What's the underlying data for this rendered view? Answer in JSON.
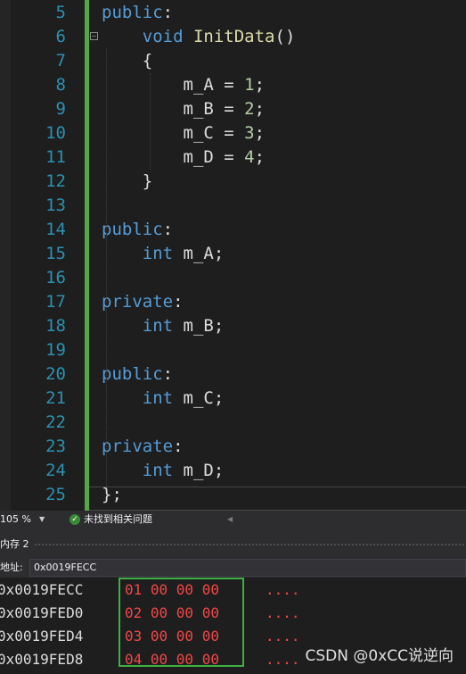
{
  "editor": {
    "lines": [
      {
        "n": "5",
        "tokens": [
          {
            "t": "public",
            "c": "kw"
          },
          {
            "t": ":",
            "c": ""
          }
        ]
      },
      {
        "n": "6",
        "tokens": [
          {
            "t": "    ",
            "c": ""
          },
          {
            "t": "void",
            "c": "kw"
          },
          {
            "t": " ",
            "c": ""
          },
          {
            "t": "InitData",
            "c": "fn"
          },
          {
            "t": "()",
            "c": ""
          }
        ]
      },
      {
        "n": "7",
        "tokens": [
          {
            "t": "    {",
            "c": ""
          }
        ]
      },
      {
        "n": "8",
        "tokens": [
          {
            "t": "        m_A = ",
            "c": ""
          },
          {
            "t": "1",
            "c": "num"
          },
          {
            "t": ";",
            "c": ""
          }
        ]
      },
      {
        "n": "9",
        "tokens": [
          {
            "t": "        m_B = ",
            "c": ""
          },
          {
            "t": "2",
            "c": "num"
          },
          {
            "t": ";",
            "c": ""
          }
        ]
      },
      {
        "n": "10",
        "tokens": [
          {
            "t": "        m_C = ",
            "c": ""
          },
          {
            "t": "3",
            "c": "num"
          },
          {
            "t": ";",
            "c": ""
          }
        ]
      },
      {
        "n": "11",
        "tokens": [
          {
            "t": "        m_D = ",
            "c": ""
          },
          {
            "t": "4",
            "c": "num"
          },
          {
            "t": ";",
            "c": ""
          }
        ]
      },
      {
        "n": "12",
        "tokens": [
          {
            "t": "    }",
            "c": ""
          }
        ]
      },
      {
        "n": "13",
        "tokens": []
      },
      {
        "n": "14",
        "tokens": [
          {
            "t": "public",
            "c": "kw"
          },
          {
            "t": ":",
            "c": ""
          }
        ]
      },
      {
        "n": "15",
        "tokens": [
          {
            "t": "    ",
            "c": ""
          },
          {
            "t": "int",
            "c": "kw"
          },
          {
            "t": " m_A;",
            "c": ""
          }
        ]
      },
      {
        "n": "16",
        "tokens": []
      },
      {
        "n": "17",
        "tokens": [
          {
            "t": "private",
            "c": "kw"
          },
          {
            "t": ":",
            "c": ""
          }
        ]
      },
      {
        "n": "18",
        "tokens": [
          {
            "t": "    ",
            "c": ""
          },
          {
            "t": "int",
            "c": "kw"
          },
          {
            "t": " m_B;",
            "c": ""
          }
        ]
      },
      {
        "n": "19",
        "tokens": []
      },
      {
        "n": "20",
        "tokens": [
          {
            "t": "public",
            "c": "kw"
          },
          {
            "t": ":",
            "c": ""
          }
        ]
      },
      {
        "n": "21",
        "tokens": [
          {
            "t": "    ",
            "c": ""
          },
          {
            "t": "int",
            "c": "kw"
          },
          {
            "t": " m_C;",
            "c": ""
          }
        ]
      },
      {
        "n": "22",
        "tokens": []
      },
      {
        "n": "23",
        "tokens": [
          {
            "t": "private",
            "c": "kw"
          },
          {
            "t": ":",
            "c": ""
          }
        ]
      },
      {
        "n": "24",
        "tokens": [
          {
            "t": "    ",
            "c": ""
          },
          {
            "t": "int",
            "c": "kw"
          },
          {
            "t": " m_D;",
            "c": ""
          }
        ]
      },
      {
        "n": "25",
        "tokens": [
          {
            "t": "};",
            "c": ""
          }
        ]
      }
    ],
    "fold_symbol": "−"
  },
  "status_bar": {
    "zoom": "105 %",
    "zoom_arrow": "▼",
    "issues_icon": "✓",
    "issues_text": "未找到相关问题",
    "scroll_arrow": "◀"
  },
  "memory": {
    "title": "内存 2",
    "address_label": "地址:",
    "address_value": "0x0019FECC",
    "rows": [
      {
        "address": "0x0019FECC",
        "bytes": "01 00 00 00",
        "ascii": "...."
      },
      {
        "address": "0x0019FED0",
        "bytes": "02 00 00 00",
        "ascii": "...."
      },
      {
        "address": "0x0019FED4",
        "bytes": "03 00 00 00",
        "ascii": "...."
      },
      {
        "address": "0x0019FED8",
        "bytes": "04 00 00 00",
        "ascii": "...."
      }
    ]
  },
  "watermark": "CSDN @0xCC说逆向",
  "colors": {
    "keyword": "#569cd6",
    "function": "#dcdcaa",
    "number": "#b5cea8",
    "line_number": "#2b91af",
    "memory_value": "#f04848",
    "highlight_box": "#3cb043",
    "change_bar": "#57a64a"
  }
}
